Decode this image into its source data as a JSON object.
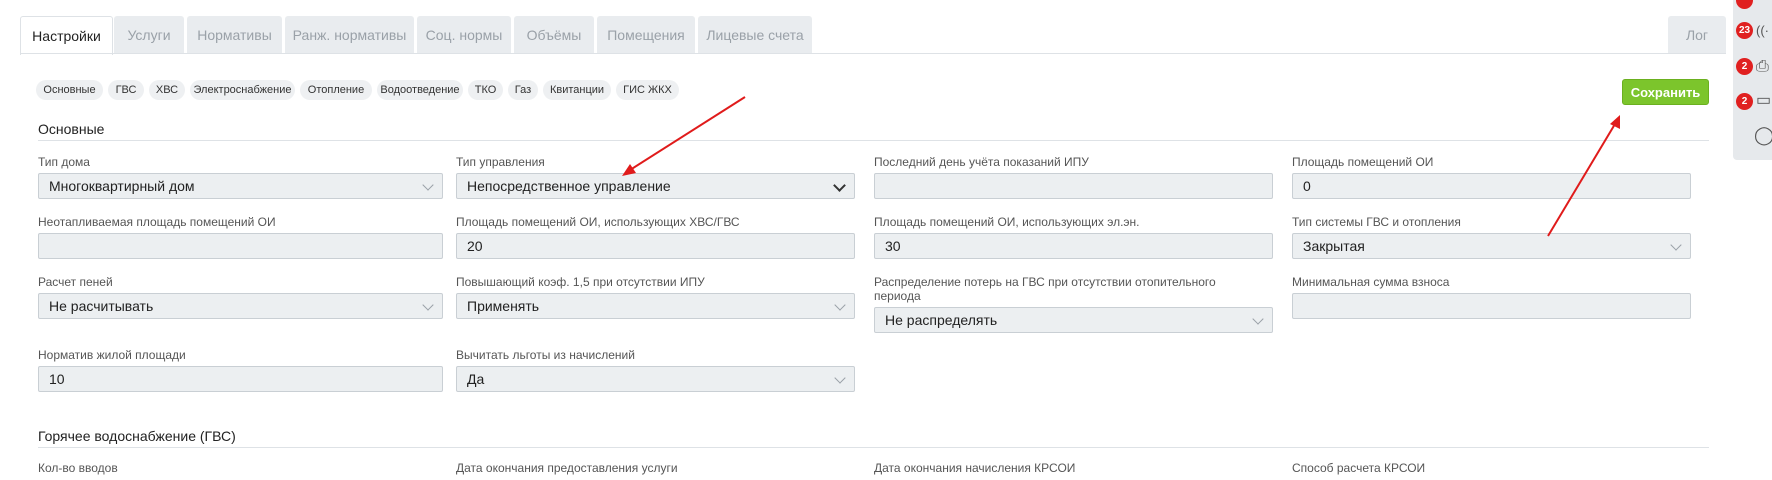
{
  "tabs": [
    "Настройки",
    "Услуги",
    "Нормативы",
    "Ранж. нормативы",
    "Соц. нормы",
    "Объёмы",
    "Помещения",
    "Лицевые счета"
  ],
  "tab_log": "Лог",
  "pills": [
    "Основные",
    "ГВС",
    "ХВС",
    "Электроснабжение",
    "Отопление",
    "Водоотведение",
    "ТКО",
    "Газ",
    "Квитанции",
    "ГИС ЖКХ"
  ],
  "save_label": "Сохранить",
  "section_main": "Основные",
  "fields": {
    "house_type": {
      "label": "Тип дома",
      "value": "Многоквартирный дом"
    },
    "mgmt_type": {
      "label": "Тип управления",
      "value": "Непосредственное управление"
    },
    "last_day": {
      "label": "Последний день учёта показаний ИПУ",
      "value": ""
    },
    "oi_area": {
      "label": "Площадь помещений ОИ",
      "value": "0"
    },
    "unheated_area": {
      "label": "Неотапливаемая площадь помещений ОИ",
      "value": ""
    },
    "oi_water_area": {
      "label": "Площадь помещений ОИ, использующих ХВС/ГВС",
      "value": "20"
    },
    "oi_elec_area": {
      "label": "Площадь помещений ОИ, использующих эл.эн.",
      "value": "30"
    },
    "gvs_system": {
      "label": "Тип системы ГВС и отопления",
      "value": "Закрытая"
    },
    "penalty": {
      "label": "Расчет пеней",
      "value": "Не расчитывать"
    },
    "coef": {
      "label": "Повышающий коэф. 1,5 при отсутствии ИПУ",
      "value": "Применять"
    },
    "loss": {
      "label": "Распределение потерь на ГВС при отсутствии отопительного",
      "label2": "периода",
      "value": "Не распределять"
    },
    "min_fee": {
      "label": "Минимальная сумма взноса",
      "value": ""
    },
    "living_norm": {
      "label": "Норматив жилой площади",
      "value": "10"
    },
    "benefits": {
      "label": "Вычитать льготы из начислений",
      "value": "Да"
    }
  },
  "section_gvs": "Горячее водоснабжение (ГВС)",
  "gvs_labels": [
    "Кол-во вводов",
    "Дата окончания предоставления услуги",
    "Дата окончания начисления КРСОИ",
    "Способ расчета КРСОИ"
  ],
  "side_badges": [
    "23",
    "2",
    "2"
  ],
  "colors": {
    "save": "#7cc52c",
    "arrow": "#e01b1b",
    "badge": "#e02020"
  }
}
